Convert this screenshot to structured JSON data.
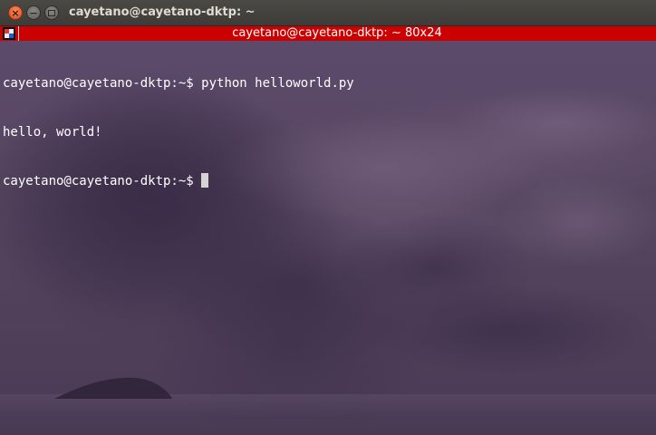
{
  "window": {
    "title": "cayetano@cayetano-dktp: ~",
    "close_glyph": "×",
    "minimize_glyph": "−"
  },
  "statusbar": {
    "title": "cayetano@cayetano-dktp: ~ 80x24",
    "color": "#cc0000"
  },
  "terminal": {
    "lines": [
      {
        "prompt": "cayetano@cayetano-dktp:~$ ",
        "command": "python helloworld.py"
      },
      {
        "output": "hello, world!"
      },
      {
        "prompt": "cayetano@cayetano-dktp:~$ ",
        "command": ""
      }
    ]
  },
  "colors": {
    "text": "#ffffff",
    "background": "#57465f"
  },
  "icons": [
    "close-icon",
    "minimize-icon",
    "maximize-icon",
    "terminal-app-icon",
    "cursor-block"
  ]
}
